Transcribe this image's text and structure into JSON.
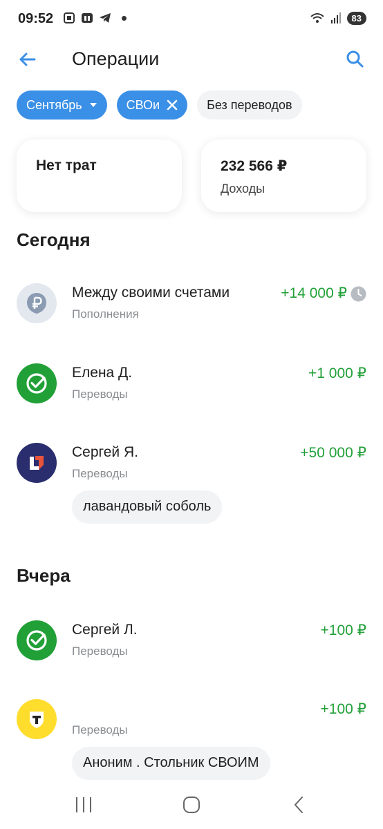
{
  "status_bar": {
    "time": "09:52",
    "battery": "83"
  },
  "header": {
    "title": "Операции"
  },
  "filters": {
    "month": "Сентябрь",
    "tag": "СВОи",
    "no_transfers": "Без переводов"
  },
  "summary": {
    "expenses": "Нет трат",
    "income_value": "232 566 ₽",
    "income_label": "Доходы"
  },
  "sections": {
    "today": "Сегодня",
    "yesterday": "Вчера"
  },
  "operations": [
    {
      "name": "Между своими счетами",
      "category": "Пополнения",
      "amount": "+14 000 ₽",
      "icon": "ruble-icon",
      "pending": true
    },
    {
      "name": "Елена Д.",
      "category": "Переводы",
      "amount": "+1 000 ₽",
      "icon": "sber-icon"
    },
    {
      "name": "Сергей Я.",
      "category": "Переводы",
      "amount": "+50 000 ₽",
      "icon": "bank-logo-icon",
      "note": "лавандовый соболь"
    },
    {
      "name": "Сергей Л.",
      "category": "Переводы",
      "amount": "+100 ₽",
      "icon": "sber-icon"
    },
    {
      "name": "",
      "category": "Переводы",
      "amount": "+100 ₽",
      "icon": "tbank-icon",
      "note": "Аноним . Стольник СВОИМ"
    }
  ],
  "colors": {
    "accent": "#3a8fe6",
    "positive": "#21a038",
    "sber_green": "#21a038",
    "tbank_yellow": "#ffdd2d",
    "bank_logo_bg": "#2a2e6e"
  }
}
